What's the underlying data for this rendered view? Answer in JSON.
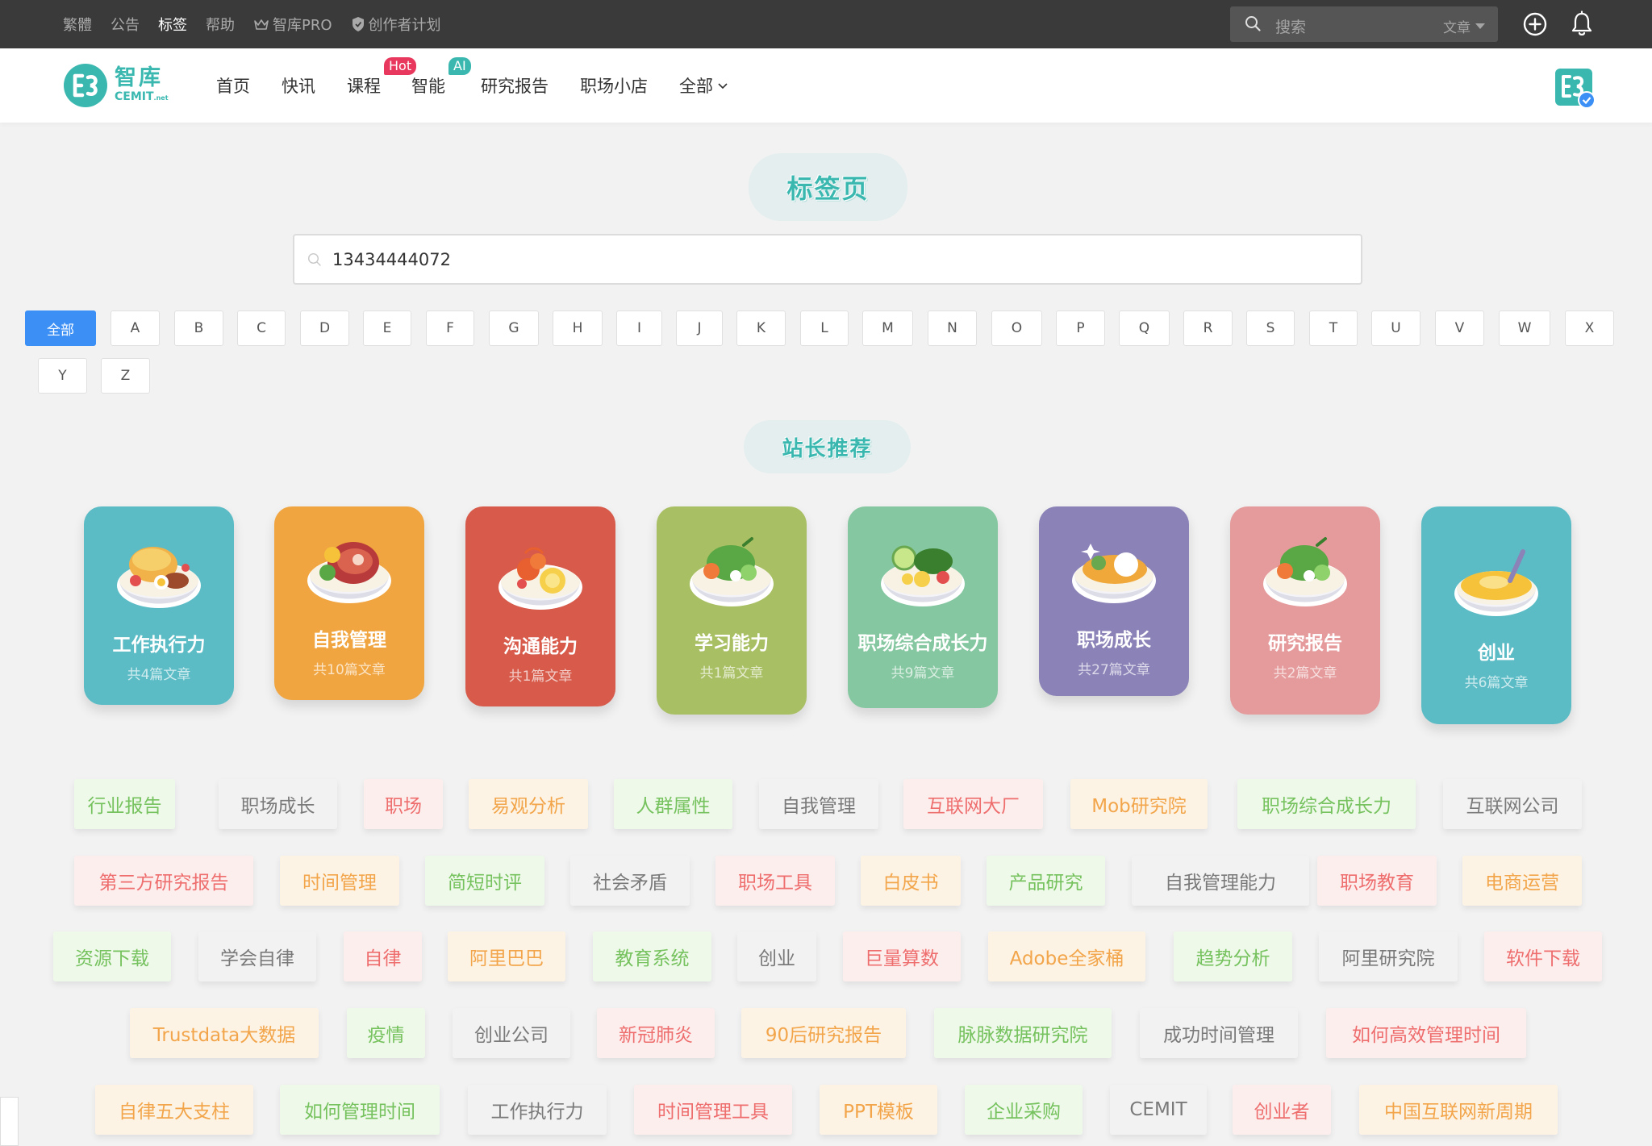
{
  "topbar": {
    "links": [
      "繁體",
      "公告",
      "标签",
      "帮助",
      "智库PRO",
      "创作者计划"
    ],
    "active_link": "标签",
    "search_placeholder": "搜索",
    "search_scope": "文章"
  },
  "nav": {
    "logo_cn": "智库",
    "logo_en": "CEMIT",
    "logo_en_suffix": ".net",
    "items": [
      "首页",
      "快讯",
      "课程",
      "智能",
      "研究报告",
      "职场小店",
      "全部"
    ],
    "badge_hot": "Hot",
    "badge_ai": "AI"
  },
  "page": {
    "title": "标签页",
    "search_value": "13434444072",
    "recommend_title": "站长推荐"
  },
  "letters": [
    "全部",
    "A",
    "B",
    "C",
    "D",
    "E",
    "F",
    "G",
    "H",
    "I",
    "J",
    "K",
    "L",
    "M",
    "N",
    "O",
    "P",
    "Q",
    "R",
    "S",
    "T",
    "U",
    "V",
    "W",
    "X",
    "Y",
    "Z"
  ],
  "active_letter": "全部",
  "cards": [
    {
      "title": "工作执行力",
      "count": "共4篇文章",
      "color": "#5cbcc6"
    },
    {
      "title": "自我管理",
      "count": "共10篇文章",
      "color": "#f0a540"
    },
    {
      "title": "沟通能力",
      "count": "共1篇文章",
      "color": "#d75a4a"
    },
    {
      "title": "学习能力",
      "count": "共1篇文章",
      "color": "#a9bf63"
    },
    {
      "title": "职场综合成长力",
      "count": "共9篇文章",
      "color": "#85c7a0"
    },
    {
      "title": "职场成长",
      "count": "共27篇文章",
      "color": "#8b82b7"
    },
    {
      "title": "研究报告",
      "count": "共2篇文章",
      "color": "#e59a9b"
    },
    {
      "title": "创业",
      "count": "共6篇文章",
      "color": "#5cbcc6"
    }
  ],
  "tags": [
    {
      "label": "行业报告",
      "style": "g"
    },
    {
      "label": "职场成长",
      "style": "n"
    },
    {
      "label": "职场",
      "style": "r"
    },
    {
      "label": "易观分析",
      "style": "o"
    },
    {
      "label": "人群属性",
      "style": "g"
    },
    {
      "label": "自我管理",
      "style": "n"
    },
    {
      "label": "互联网大厂",
      "style": "r"
    },
    {
      "label": "Mob研究院",
      "style": "o"
    },
    {
      "label": "职场综合成长力",
      "style": "g"
    },
    {
      "label": "互联网公司",
      "style": "n"
    },
    {
      "label": "第三方研究报告",
      "style": "r"
    },
    {
      "label": "时间管理",
      "style": "o"
    },
    {
      "label": "简短时评",
      "style": "g"
    },
    {
      "label": "社会矛盾",
      "style": "n"
    },
    {
      "label": "职场工具",
      "style": "r"
    },
    {
      "label": "白皮书",
      "style": "o"
    },
    {
      "label": "产品研究",
      "style": "g"
    },
    {
      "label": "自我管理能力",
      "style": "n"
    },
    {
      "label": "职场教育",
      "style": "r"
    },
    {
      "label": "电商运营",
      "style": "o"
    },
    {
      "label": "资源下载",
      "style": "g"
    },
    {
      "label": "学会自律",
      "style": "n"
    },
    {
      "label": "自律",
      "style": "r"
    },
    {
      "label": "阿里巴巴",
      "style": "o"
    },
    {
      "label": "教育系统",
      "style": "g"
    },
    {
      "label": "创业",
      "style": "n"
    },
    {
      "label": "巨量算数",
      "style": "r"
    },
    {
      "label": "Adobe全家桶",
      "style": "o"
    },
    {
      "label": "趋势分析",
      "style": "g"
    },
    {
      "label": "阿里研究院",
      "style": "n"
    },
    {
      "label": "软件下载",
      "style": "r"
    },
    {
      "label": "Trustdata大数据",
      "style": "o"
    },
    {
      "label": "疫情",
      "style": "g"
    },
    {
      "label": "创业公司",
      "style": "n"
    },
    {
      "label": "新冠肺炎",
      "style": "r"
    },
    {
      "label": "90后研究报告",
      "style": "o"
    },
    {
      "label": "脉脉数据研究院",
      "style": "g"
    },
    {
      "label": "成功时间管理",
      "style": "n"
    },
    {
      "label": "如何高效管理时间",
      "style": "r"
    },
    {
      "label": "自律五大支柱",
      "style": "o"
    },
    {
      "label": "如何管理时间",
      "style": "g"
    },
    {
      "label": "工作执行力",
      "style": "n"
    },
    {
      "label": "时间管理工具",
      "style": "r"
    },
    {
      "label": "PPT模板",
      "style": "o"
    },
    {
      "label": "企业采购",
      "style": "g"
    },
    {
      "label": "CEMIT",
      "style": "n"
    },
    {
      "label": "创业者",
      "style": "r"
    },
    {
      "label": "中国互联网新周期",
      "style": "o"
    }
  ]
}
